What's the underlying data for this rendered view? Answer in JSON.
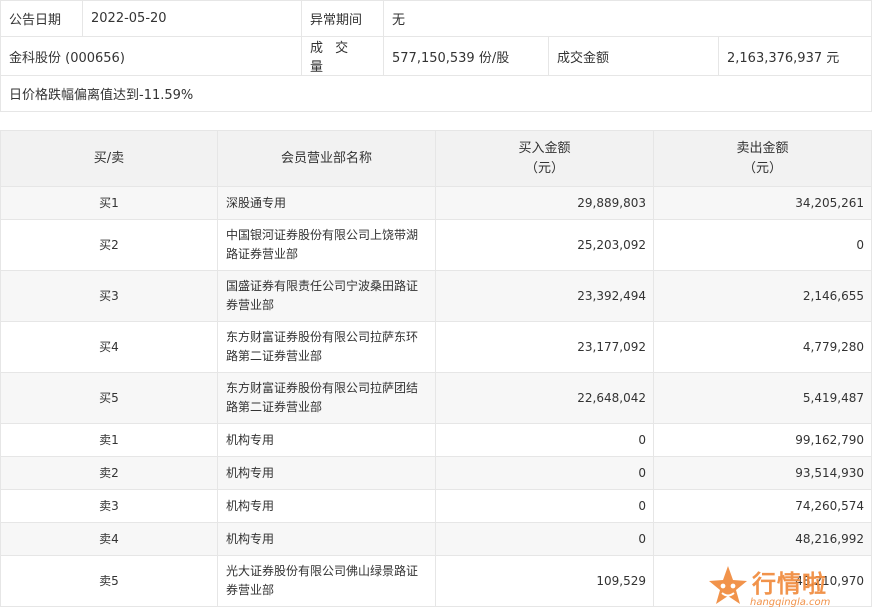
{
  "info": {
    "announce_date_label": "公告日期",
    "announce_date": "2022-05-20",
    "abnormal_period_label": "异常期间",
    "abnormal_period": "无",
    "stock_name": "金科股份 (000656)",
    "volume_label": "成 交 量",
    "volume": "577,150,539 份/股",
    "turnover_label": "成交金额",
    "turnover": "2,163,376,937 元",
    "reason": "日价格跌幅偏离值达到-11.59%"
  },
  "table": {
    "headers": {
      "side": "买/卖",
      "branch": "会员营业部名称",
      "buy_amount": "买入金额",
      "buy_unit": "（元）",
      "sell_amount": "卖出金额",
      "sell_unit": "（元）"
    },
    "rows": [
      {
        "side": "买1",
        "branch": "深股通专用",
        "buy": "29,889,803",
        "sell": "34,205,261"
      },
      {
        "side": "买2",
        "branch": "中国银河证券股份有限公司上饶带湖路证券营业部",
        "buy": "25,203,092",
        "sell": "0"
      },
      {
        "side": "买3",
        "branch": "国盛证券有限责任公司宁波桑田路证券营业部",
        "buy": "23,392,494",
        "sell": "2,146,655"
      },
      {
        "side": "买4",
        "branch": "东方财富证券股份有限公司拉萨东环路第二证券营业部",
        "buy": "23,177,092",
        "sell": "4,779,280"
      },
      {
        "side": "买5",
        "branch": "东方财富证券股份有限公司拉萨团结路第二证券营业部",
        "buy": "22,648,042",
        "sell": "5,419,487"
      },
      {
        "side": "卖1",
        "branch": "机构专用",
        "buy": "0",
        "sell": "99,162,790"
      },
      {
        "side": "卖2",
        "branch": "机构专用",
        "buy": "0",
        "sell": "93,514,930"
      },
      {
        "side": "卖3",
        "branch": "机构专用",
        "buy": "0",
        "sell": "74,260,574"
      },
      {
        "side": "卖4",
        "branch": "机构专用",
        "buy": "0",
        "sell": "48,216,992"
      },
      {
        "side": "卖5",
        "branch": "光大证券股份有限公司佛山绿景路证券营业部",
        "buy": "109,529",
        "sell": "48,210,970"
      }
    ]
  },
  "watermark": {
    "brand": "行情啦",
    "site": "hangqingla.com",
    "color": "#f08a3c"
  }
}
